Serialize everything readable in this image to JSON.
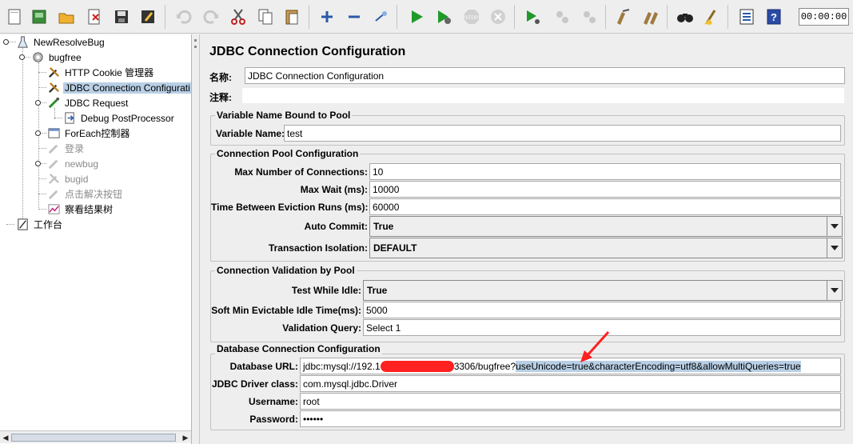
{
  "toolbar": {
    "timer": "00:00:00",
    "icons": [
      "new-icon",
      "templates-icon",
      "open-icon",
      "close-icon",
      "save-icon",
      "save-as-icon",
      "undo-icon",
      "redo-icon",
      "cut-icon",
      "copy-icon",
      "paste-icon",
      "expand-icon",
      "collapse-icon",
      "toggle-icon",
      "start-icon",
      "start-no-pause-icon",
      "stop-icon",
      "shutdown-icon",
      "remote-start-icon",
      "remote-stop-icon",
      "remote-shutdown-icon",
      "clear-icon",
      "clear-all-icon",
      "search-icon",
      "reset-search-icon",
      "function-helper-icon",
      "help-icon"
    ]
  },
  "tree": {
    "items": [
      {
        "label": "NewResolveBug"
      },
      {
        "label": "bugfree"
      },
      {
        "label": "HTTP Cookie 管理器"
      },
      {
        "label": "JDBC Connection Configurati"
      },
      {
        "label": "JDBC Request"
      },
      {
        "label": "Debug PostProcessor"
      },
      {
        "label": "ForEach控制器"
      },
      {
        "label": "登录"
      },
      {
        "label": "newbug"
      },
      {
        "label": "bugid"
      },
      {
        "label": "点击解决按钮"
      },
      {
        "label": "察看结果树"
      },
      {
        "label": "工作台"
      }
    ]
  },
  "main": {
    "title": "JDBC Connection Configuration",
    "name_label": "名称:",
    "name_value": "JDBC Connection Configuration",
    "comment_label": "注释:",
    "comment_value": "",
    "pool_bound": {
      "title": "Variable Name Bound to Pool",
      "variable_label": "Variable Name:",
      "variable_value": "test"
    },
    "pool_config": {
      "title": "Connection Pool Configuration",
      "max_conn_label": "Max Number of Connections:",
      "max_conn_value": "10",
      "max_wait_label": "Max Wait (ms):",
      "max_wait_value": "10000",
      "eviction_label": "Time Between Eviction Runs (ms):",
      "eviction_value": "60000",
      "auto_commit_label": "Auto Commit:",
      "auto_commit_value": "True",
      "isolation_label": "Transaction Isolation:",
      "isolation_value": "DEFAULT"
    },
    "validation": {
      "title": "Connection Validation by Pool",
      "test_idle_label": "Test While Idle:",
      "test_idle_value": "True",
      "soft_min_label": "Soft Min Evictable Idle Time(ms):",
      "soft_min_value": "5000",
      "query_label": "Validation Query:",
      "query_value": "Select 1"
    },
    "db": {
      "title": "Database Connection Configuration",
      "url_label": "Database URL:",
      "url_prefix": "jdbc:mysql://192.1",
      "url_middle": "3306/bugfree?",
      "url_params": "useUnicode=true&characterEncoding=utf8&allowMultiQueries=true",
      "driver_label": "JDBC Driver class:",
      "driver_value": "com.mysql.jdbc.Driver",
      "username_label": "Username:",
      "username_value": "root",
      "password_label": "Password:",
      "password_value": "••••••"
    }
  },
  "colors": {
    "selection": "#b8cfe5",
    "annotation_arrow": "#ff2020",
    "play_green": "#1f9a2a"
  }
}
